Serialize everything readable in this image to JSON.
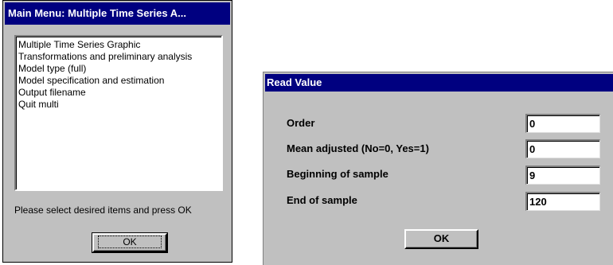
{
  "main_menu": {
    "title": "Main Menu: Multiple Time Series A...",
    "items": [
      "Multiple Time Series Graphic",
      "Transformations and preliminary analysis",
      "Model type (full)",
      "Model specification and estimation",
      "Output filename",
      "Quit multi"
    ],
    "instruction": "Please select desired items and press OK",
    "ok_label": "OK"
  },
  "read_value": {
    "title": "Read Value",
    "fields": [
      {
        "label": "Order",
        "value": "0"
      },
      {
        "label": "Mean adjusted (No=0, Yes=1)",
        "value": "0"
      },
      {
        "label": "Beginning of sample",
        "value": "9"
      },
      {
        "label": "End of sample",
        "value": "120"
      }
    ],
    "ok_label": "OK"
  }
}
